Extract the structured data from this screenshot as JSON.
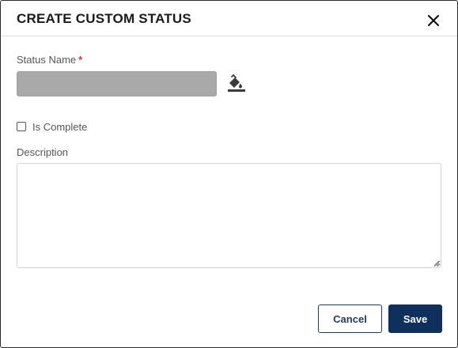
{
  "dialog": {
    "title": "CREATE CUSTOM STATUS"
  },
  "form": {
    "status_name_label": "Status Name",
    "required_mark": "*",
    "status_name_value": "",
    "status_fill_color": "#a9a9a9",
    "is_complete_label": "Is Complete",
    "is_complete_checked": false,
    "description_label": "Description",
    "description_value": ""
  },
  "footer": {
    "cancel_label": "Cancel",
    "save_label": "Save"
  },
  "icons": {
    "close": "close-icon",
    "color_picker": "paint-bucket-icon"
  },
  "colors": {
    "primary": "#0f2f5c",
    "required": "#d9342b"
  }
}
